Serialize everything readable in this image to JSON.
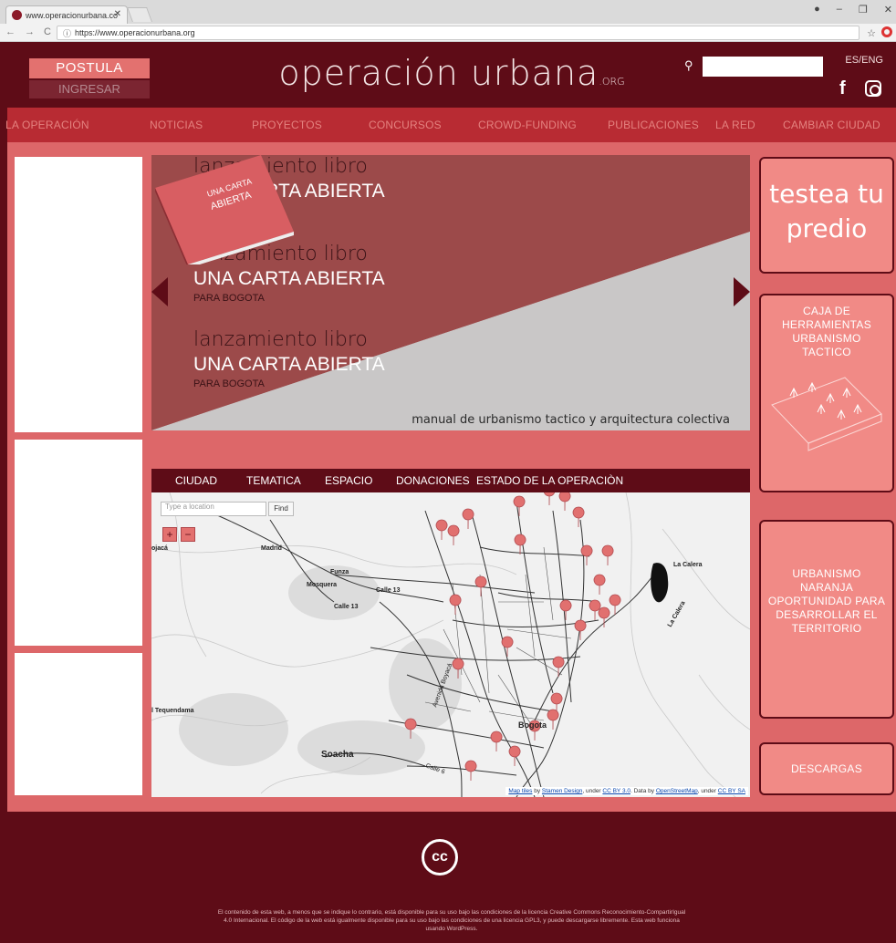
{
  "browser": {
    "tab_title": "www.operacionurbana.co",
    "url": "https://www.operacionurbana.org"
  },
  "header": {
    "postula": "POSTULA",
    "ingresar": "INGRESAR",
    "logo": "operación urbana",
    "logo_suffix": ".ORG",
    "lang": "ES/ENG"
  },
  "nav": {
    "items": [
      "LA OPERACIÓN",
      "NOTICIAS",
      "PROYECTOS",
      "CONCURSOS",
      "CROWD-FUNDING",
      "PUBLICACIONES",
      "LA RED",
      "CAMBIAR CIUDAD"
    ]
  },
  "slider": {
    "blocks": [
      {
        "l1": "lanzamiento libro",
        "l2": "UNA CARTA ABIERTA",
        "l3": "PARA BOGOTA"
      },
      {
        "l1": "lanzamiento libro",
        "l2": "UNA CARTA ABIERTA",
        "l3": "PARA BOGOTA"
      },
      {
        "l1": "lanzamiento libro",
        "l2": "UNA CARTA ABIERTA",
        "l3": "PARA BOGOTA"
      }
    ],
    "book_title_1": "UNA CARTA",
    "book_title_2": "ABIERTA",
    "caption": "manual de urbanismo tactico y arquitectura colectiva"
  },
  "sidebar": {
    "testea_1": "testea tu",
    "testea_2": "predio",
    "caja": [
      "CAJA DE",
      "HERRAMIENTAS",
      "URBANISMO",
      "TACTICO"
    ],
    "naranja": [
      "URBANISMO",
      "NARANJA",
      "OPORTUNIDAD PARA",
      "DESARROLLAR EL",
      "TERRITORIO"
    ],
    "descargas": "DESCARGAS"
  },
  "map": {
    "tabs": [
      "CIUDAD",
      "TEMATICA",
      "ESPACIO",
      "DONACIONES",
      "ESTADO DE LA OPERACIÒN"
    ],
    "search_placeholder": "Type a location",
    "find": "Find",
    "zoom_in": "+",
    "zoom_out": "−",
    "labels": [
      "Madrid",
      "Mosquera",
      "Funza",
      "Calle 13",
      "Calle 13",
      "La Calera",
      "La Calera",
      "Bogota",
      "Soacha",
      "l Tequendama",
      "ojacá",
      "Avenida Boyacá",
      "Calle 6"
    ],
    "attribution": {
      "a1": "Map tiles",
      "a2": " by ",
      "a3": "Stamen Design",
      "a4": ", under ",
      "a5": "CC BY 3.0",
      "a6": ". Data by ",
      "a7": "OpenStreetMap",
      "a8": ", under ",
      "a9": "CC BY SA"
    }
  },
  "footer": {
    "cc": "cc",
    "text": "El contenido de esta web, a menos que se indique lo contrario, está disponible para su uso bajo las condiciones de la licencia Creative Commons Reconocimiento-CompartirIgual 4.0 Internacional. El código de la web está igualmente disponible para su uso bajo las condiciones de una licencia GPL3, y puede descargarse libremente. Esta web funciona usando WordPress."
  },
  "colors": {
    "dark": "#5e0c17",
    "red": "#b82b33",
    "salmon": "#dd6769",
    "card": "#f18a86"
  }
}
